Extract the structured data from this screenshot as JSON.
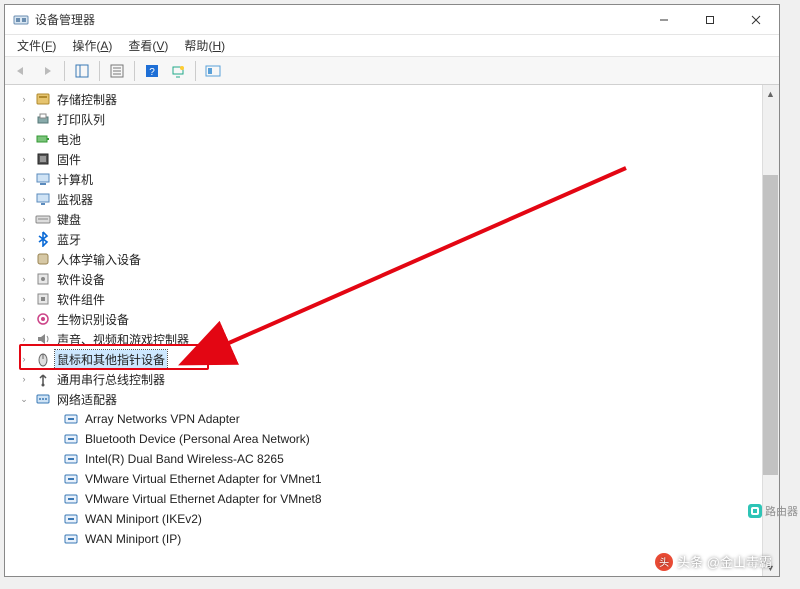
{
  "window": {
    "title": "设备管理器"
  },
  "menu": {
    "file": {
      "label": "文件",
      "hotkey": "F"
    },
    "action": {
      "label": "操作",
      "hotkey": "A"
    },
    "view": {
      "label": "查看",
      "hotkey": "V"
    },
    "help": {
      "label": "帮助",
      "hotkey": "H"
    }
  },
  "tree": {
    "items": [
      {
        "id": "storage-controllers",
        "label": "存储控制器",
        "icon": "storage",
        "expandable": true
      },
      {
        "id": "print-queues",
        "label": "打印队列",
        "icon": "printer",
        "expandable": true
      },
      {
        "id": "batteries",
        "label": "电池",
        "icon": "battery",
        "expandable": true
      },
      {
        "id": "firmware",
        "label": "固件",
        "icon": "firmware",
        "expandable": true
      },
      {
        "id": "computer",
        "label": "计算机",
        "icon": "computer",
        "expandable": true
      },
      {
        "id": "monitors",
        "label": "监视器",
        "icon": "monitor",
        "expandable": true
      },
      {
        "id": "keyboards",
        "label": "键盘",
        "icon": "keyboard",
        "expandable": true
      },
      {
        "id": "bluetooth",
        "label": "蓝牙",
        "icon": "bluetooth",
        "expandable": true
      },
      {
        "id": "hid",
        "label": "人体学输入设备",
        "icon": "hid",
        "expandable": true
      },
      {
        "id": "software-devices",
        "label": "软件设备",
        "icon": "software",
        "expandable": true
      },
      {
        "id": "software-components",
        "label": "软件组件",
        "icon": "component",
        "expandable": true
      },
      {
        "id": "biometric",
        "label": "生物识别设备",
        "icon": "biometric",
        "expandable": true
      },
      {
        "id": "sound-video-game",
        "label": "声音、视频和游戏控制器",
        "icon": "audio",
        "expandable": true,
        "truncated": true
      },
      {
        "id": "mouse",
        "label": "鼠标和其他指针设备",
        "icon": "mouse",
        "expandable": true,
        "selected": true
      },
      {
        "id": "usb-controllers",
        "label": "通用串行总线控制器",
        "icon": "usb",
        "expandable": true,
        "truncated": true
      },
      {
        "id": "network-adapters",
        "label": "网络适配器",
        "icon": "network",
        "expandable": true,
        "expanded": true,
        "children": [
          {
            "label": "Array Networks VPN Adapter",
            "icon": "net-adapter"
          },
          {
            "label": "Bluetooth Device (Personal Area Network)",
            "icon": "net-adapter"
          },
          {
            "label": "Intel(R) Dual Band Wireless-AC 8265",
            "icon": "net-adapter"
          },
          {
            "label": "VMware Virtual Ethernet Adapter for VMnet1",
            "icon": "net-adapter"
          },
          {
            "label": "VMware Virtual Ethernet Adapter for VMnet8",
            "icon": "net-adapter"
          },
          {
            "label": "WAN Miniport (IKEv2)",
            "icon": "net-adapter"
          },
          {
            "label": "WAN Miniport (IP)",
            "icon": "net-adapter"
          }
        ]
      }
    ]
  },
  "watermark": {
    "prefix": "头条",
    "text": "@金山毒霸"
  },
  "side_logo": {
    "text": "路由器"
  },
  "colors": {
    "highlight_border": "#e30613",
    "selection_bg": "#cde8ff"
  }
}
